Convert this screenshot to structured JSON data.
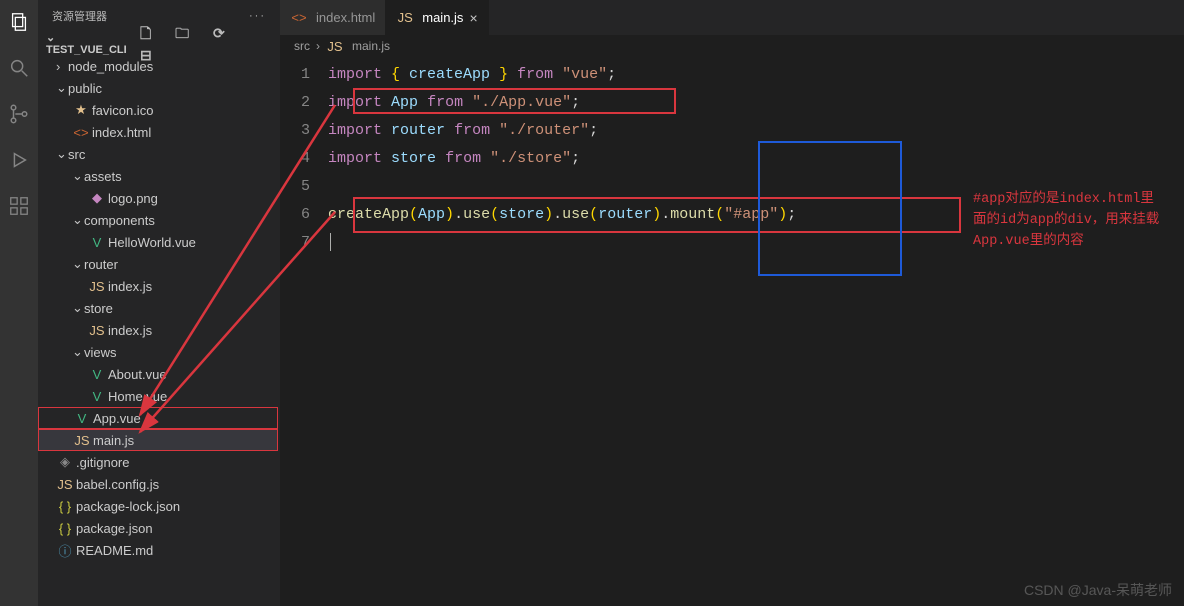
{
  "sidebar": {
    "title": "资源管理器",
    "project": "TEST_VUE_CLI",
    "items": {
      "node_modules": "node_modules",
      "public": "public",
      "favicon": "favicon.ico",
      "indexhtml": "index.html",
      "src": "src",
      "assets": "assets",
      "logo": "logo.png",
      "components": "components",
      "helloworld": "HelloWorld.vue",
      "router": "router",
      "router_index": "index.js",
      "store": "store",
      "store_index": "index.js",
      "views": "views",
      "about": "About.vue",
      "home": "Home.vue",
      "appvue": "App.vue",
      "mainjs": "main.js",
      "gitignore": ".gitignore",
      "babel": "babel.config.js",
      "pkglock": "package-lock.json",
      "pkg": "package.json",
      "readme": "README.md"
    }
  },
  "tabs": {
    "tab1_label": "index.html",
    "tab2_label": "main.js"
  },
  "breadcrumbs": {
    "p1": "src",
    "p2": "main.js"
  },
  "code": {
    "l1": {
      "kw": "import",
      "brace_l": "{ ",
      "id": "createApp",
      "brace_r": " }",
      "from": "from",
      "str": "\"vue\"",
      "semi": ";"
    },
    "l2": {
      "kw": "import",
      "id": "App",
      "from": "from",
      "str": "\"./App.vue\"",
      "semi": ";"
    },
    "l3": {
      "kw": "import",
      "id": "router",
      "from": "from",
      "str": "\"./router\"",
      "semi": ";"
    },
    "l4": {
      "kw": "import",
      "id": "store",
      "from": "from",
      "str": "\"./store\"",
      "semi": ";"
    },
    "l6": {
      "fn": "createApp",
      "arg1": "App",
      "use": "use",
      "arg2": "store",
      "arg3": "router",
      "mount": "mount",
      "arg4": "\"#app\"",
      "semi": ";"
    }
  },
  "annotation": {
    "line1": "#app对应的是index.html里",
    "line2": "面的id为app的div，用来挂载",
    "line3": "App.vue里的内容"
  },
  "watermark": "CSDN @Java-呆萌老师",
  "icons": {
    "js": "JS",
    "vue": "V",
    "html": "<>",
    "img": "◆",
    "braces": "{ }",
    "info": "ⓘ",
    "star": "★"
  }
}
